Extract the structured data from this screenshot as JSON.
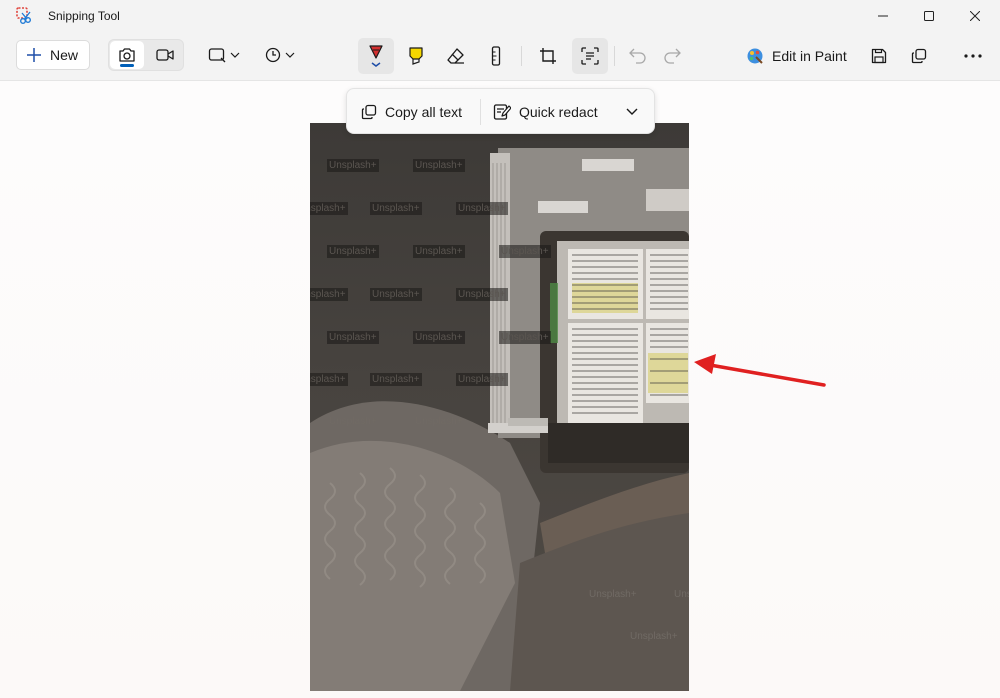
{
  "window": {
    "title": "Snipping Tool",
    "controls": [
      "minimize",
      "maximize",
      "close"
    ]
  },
  "toolbar": {
    "new_label": "New",
    "edit_in_paint_label": "Edit in Paint",
    "active_mode": "screenshot",
    "active_tools": [
      "ballpoint-pen",
      "text-actions"
    ],
    "pen_color": "#d32f2f",
    "highlighter_color": "#f5d800",
    "accent_color": "#005fb8"
  },
  "text_actions": {
    "copy_all_text_label": "Copy all text",
    "quick_redact_label": "Quick redact"
  },
  "capture": {
    "watermarks": [
      "Unsplash+"
    ],
    "annotation": {
      "type": "arrow",
      "color": "#e02020"
    }
  }
}
